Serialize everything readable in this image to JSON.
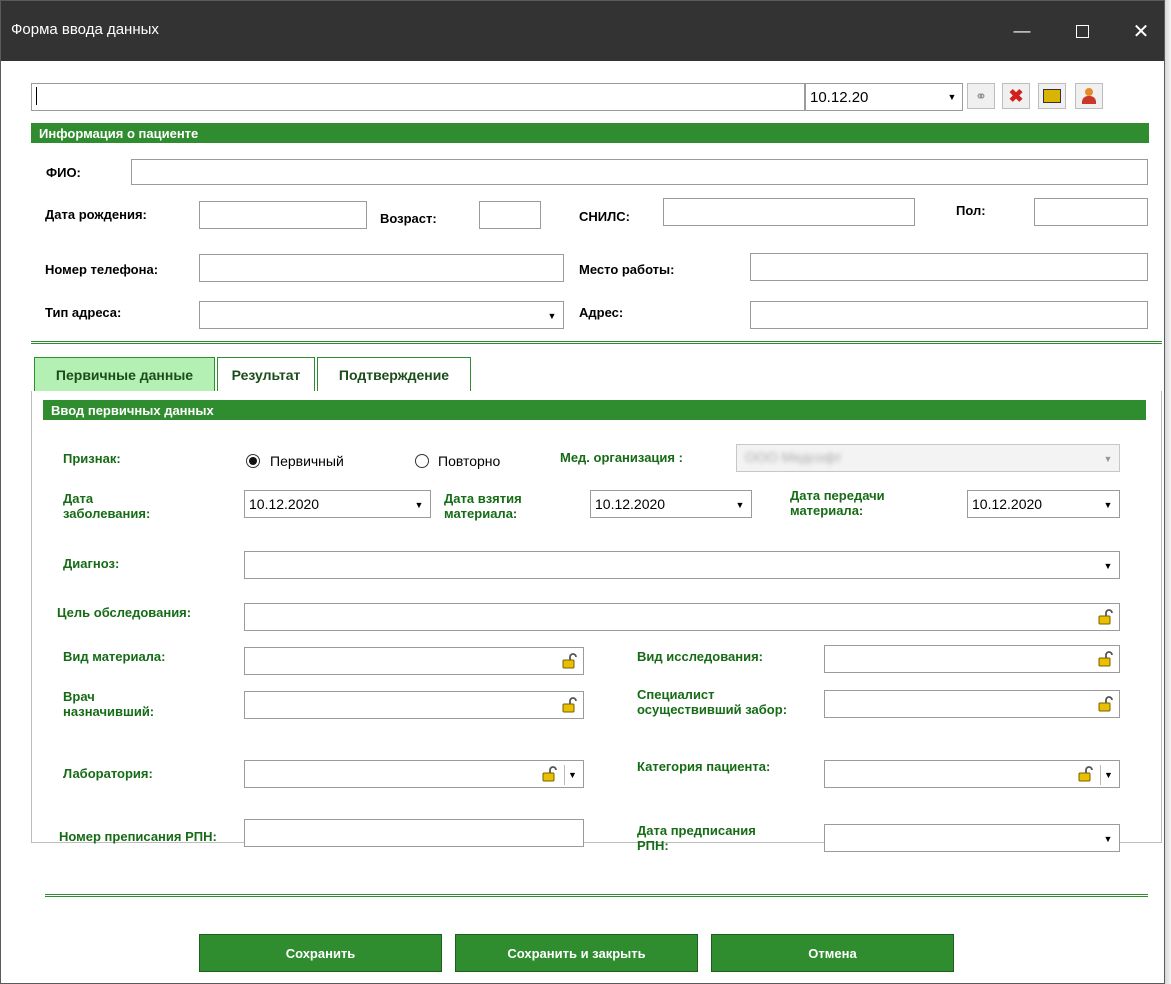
{
  "window": {
    "title": "Форма ввода данных"
  },
  "toolbar": {
    "date": "10.12.20"
  },
  "patient": {
    "header": "Информация о пациенте",
    "fio_label": "ФИО:",
    "birth_label": "Дата рождения:",
    "age_label": "Возраст:",
    "snils_label": "СНИЛС:",
    "sex_label": "Пол:",
    "phone_label": "Номер телефона:",
    "work_label": "Место работы:",
    "addrtype_label": "Тип адреса:",
    "addr_label": "Адрес:"
  },
  "tabs": [
    {
      "label": "Первичные данные"
    },
    {
      "label": "Результат"
    },
    {
      "label": "Подтверждение"
    }
  ],
  "primary": {
    "header": "Ввод первичных данных",
    "sign_label": "Признак:",
    "radio_primary": "Первичный",
    "radio_repeat": "Повторно",
    "medorg_label": "Мед. организация :",
    "medorg_value": "ООО Медсофт",
    "disease_date_label": "Дата заболевания:",
    "disease_date": "10.12.2020",
    "take_date_label": "Дата взятия материала:",
    "take_date": "10.12.2020",
    "transfer_date_label": "Дата передачи материала:",
    "transfer_date": "10.12.2020",
    "diagnosis_label": "Диагноз:",
    "purpose_label": "Цель обследования:",
    "material_label": "Вид материала:",
    "research_label": "Вид исследования:",
    "doctor_label": "Врач назначивший:",
    "specialist_label": "Специалист осуществивший забор:",
    "lab_label": "Лаборатория:",
    "category_label": "Категория пациента:",
    "rpn_number_label": "Номер преписания РПН:",
    "rpn_date_label": "Дата предписания РПН:"
  },
  "buttons": {
    "save": "Сохранить",
    "save_close": "Сохранить и закрыть",
    "cancel": "Отмена"
  }
}
